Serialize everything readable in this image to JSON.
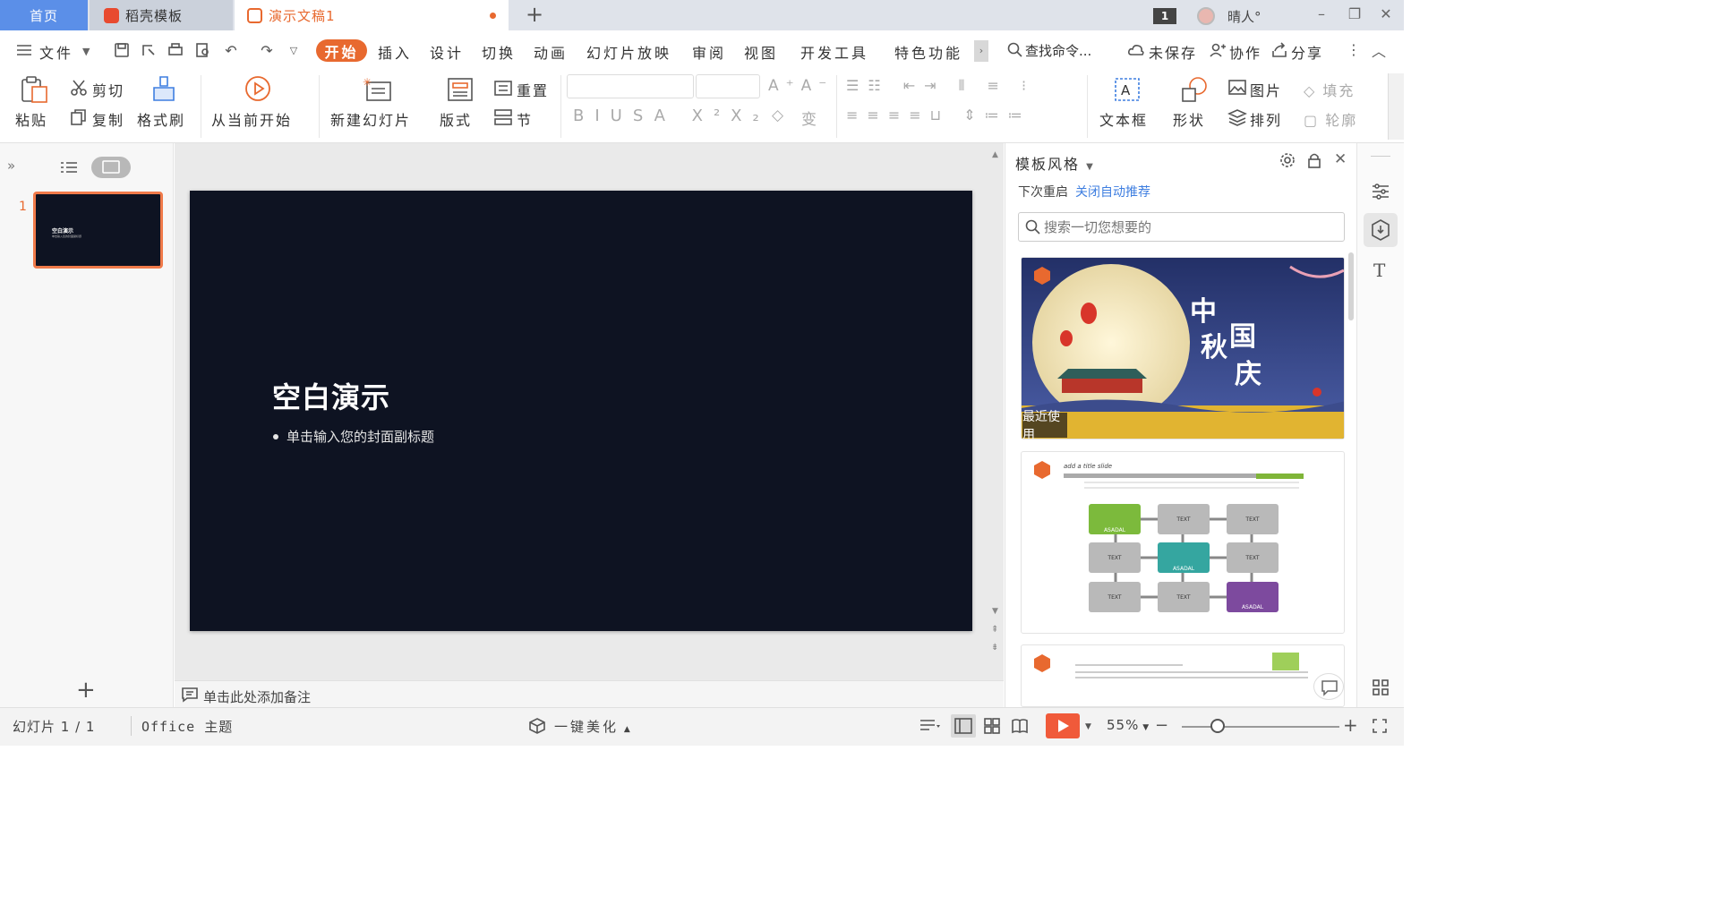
{
  "tabs": {
    "home": "首页",
    "templates": "稻壳模板",
    "document": "演示文稿1"
  },
  "window": {
    "badge": "1",
    "user_name": "晴人°"
  },
  "menu": {
    "file": "文件",
    "items": [
      "开始",
      "插入",
      "设计",
      "切换",
      "动画",
      "幻灯片放映",
      "审阅",
      "视图",
      "开发工具",
      "特色功能"
    ],
    "search": "查找命令...",
    "unsaved": "未保存",
    "collab": "协作",
    "share": "分享"
  },
  "ribbon": {
    "paste": "粘贴",
    "cut": "剪切",
    "copy": "复制",
    "format_painter": "格式刷",
    "play_from_current": "从当前开始",
    "new_slide": "新建幻灯片",
    "layout": "版式",
    "reset": "重置",
    "section": "节",
    "textbox": "文本框",
    "shape": "形状",
    "picture": "图片",
    "arrange": "排列",
    "fill": "填充",
    "outline": "轮廓"
  },
  "slide": {
    "number": "1",
    "title": "空白演示",
    "subtitle": "单击输入您的封面副标题"
  },
  "notes": {
    "placeholder": "单击此处添加备注"
  },
  "template_panel": {
    "title": "模板风格",
    "restart_text": "下次重启",
    "disable_link": "关闭自动推荐",
    "search_placeholder": "搜索一切您想要的",
    "recent_label": "最近使用",
    "template1_text": "中秋国庆",
    "template2_heading": "add a title slide",
    "template2_box_labels": [
      "ASADAL",
      "TEXT",
      "TEXT",
      "TEXT",
      "ASADAL",
      "TEXT",
      "TEXT",
      "TEXT",
      "ASADAL"
    ]
  },
  "status": {
    "slide_info": "幻灯片 1 / 1",
    "theme": "Office 主题",
    "beautify": "一键美化",
    "zoom": "55%"
  },
  "colors": {
    "accent": "#e8692f",
    "home_tab": "#5b8fe8",
    "slide_bg": "#0e1322",
    "link": "#3e7ee0"
  }
}
